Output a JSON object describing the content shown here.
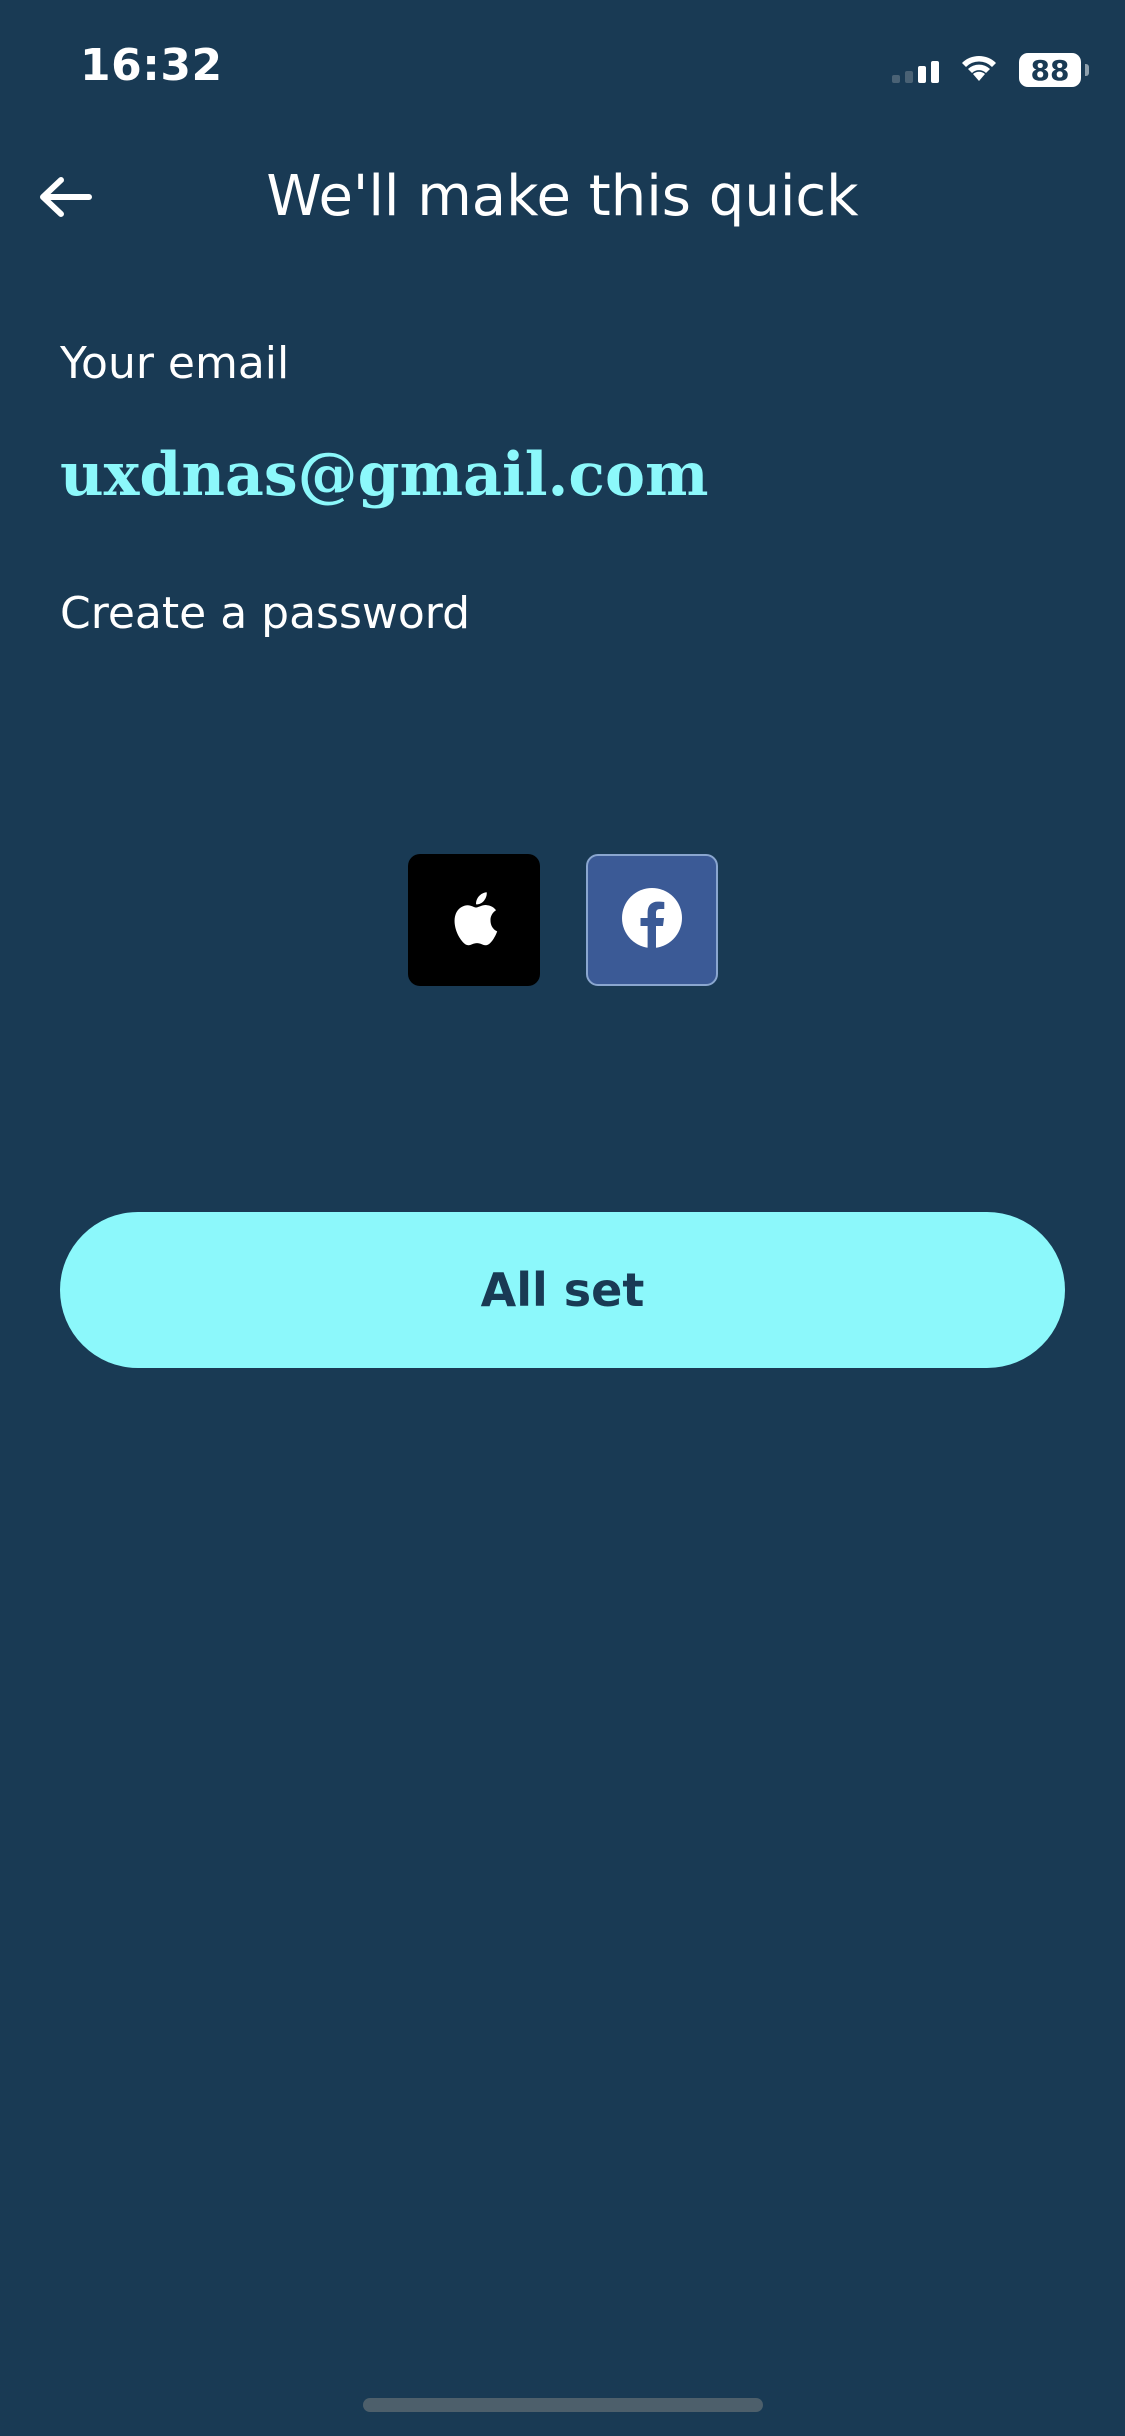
{
  "status_bar": {
    "time": "16:32",
    "battery": "88"
  },
  "header": {
    "title": "We'll make this quick"
  },
  "form": {
    "email_label": "Your email",
    "email_value": "uxdnas@gmail.com",
    "password_label": "Create a password",
    "password_value": ""
  },
  "social": {
    "apple_icon": "apple-logo",
    "facebook_icon": "facebook-logo"
  },
  "actions": {
    "submit_label": "All set"
  },
  "colors": {
    "background": "#193a54",
    "accent": "#8cf8fb",
    "apple": "#000000",
    "facebook": "#3b5a96"
  }
}
